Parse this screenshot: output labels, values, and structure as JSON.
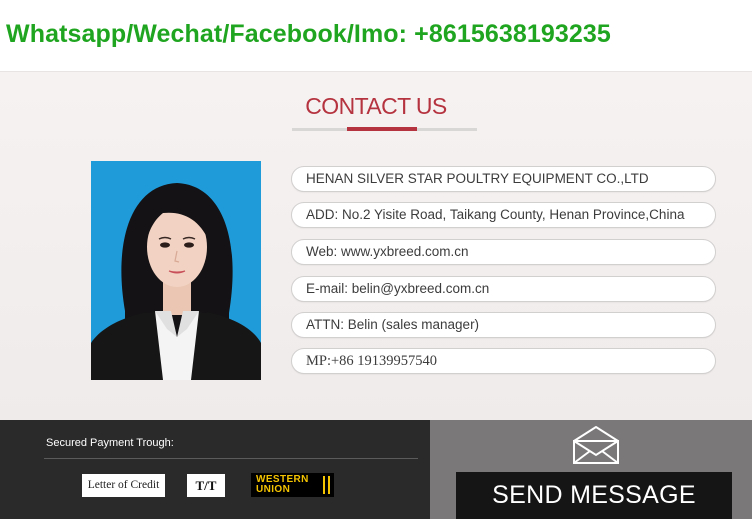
{
  "banner": {
    "contact_line": "Whatsapp/Wechat/Facebook/Imo: +8615638193235",
    "color": "#1fa51f"
  },
  "contact": {
    "title": "CONTACT US",
    "accent_color": "#b5333f",
    "fields": [
      "HENAN SILVER STAR POULTRY EQUIPMENT CO.,LTD",
      "ADD: No.2 Yisite Road, Taikang County, Henan Province,China",
      "Web: www.yxbreed.com.cn",
      "E-mail: belin@yxbreed.com.cn",
      "ATTN: Belin  (sales manager)",
      "MP:+86 19139957540"
    ]
  },
  "payment": {
    "label": "Secured Payment Trough:",
    "methods": [
      "Letter of Credit",
      "T/T",
      "WESTERN",
      "UNION"
    ]
  },
  "message": {
    "button_label": "SEND MESSAGE",
    "icon": "envelope-icon"
  }
}
